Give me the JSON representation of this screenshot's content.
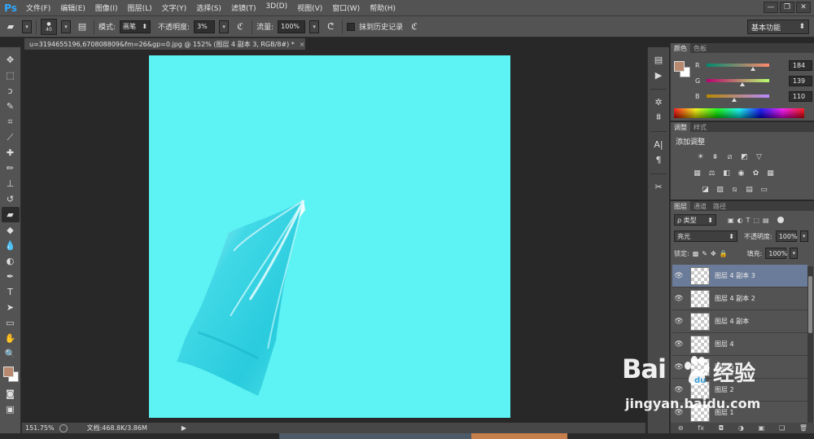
{
  "app": {
    "logo": "Ps"
  },
  "menu": [
    "文件(F)",
    "编辑(E)",
    "图像(I)",
    "图层(L)",
    "文字(Y)",
    "选择(S)",
    "滤镜(T)",
    "3D(D)",
    "视图(V)",
    "窗口(W)",
    "帮助(H)"
  ],
  "window_controls": {
    "minimize": "—",
    "restore": "❐",
    "close": "✕"
  },
  "options": {
    "brush_size": "40",
    "mode_label": "模式:",
    "mode_value": "画笔",
    "opacity_label": "不透明度:",
    "opacity_value": "3%",
    "flow_label": "流量:",
    "flow_value": "100%",
    "history_label": "抹到历史记录",
    "workspace": "基本功能"
  },
  "document": {
    "tab_title": "u=3194655196,670808809&fm=26&gp=0.jpg @ 152% (图层 4 副本 3, RGB/8#) *",
    "tab_close": "×",
    "canvas_color": "#5df2f3"
  },
  "status": {
    "zoom": "151.75%",
    "doc_info": "文档:468.8K/3.86M"
  },
  "tools": [
    "move-tool",
    "marquee-tool",
    "lasso-tool",
    "quick-select-tool",
    "crop-tool",
    "eyedropper-tool",
    "healing-tool",
    "brush-tool",
    "stamp-tool",
    "history-brush-tool",
    "eraser-tool",
    "bucket-tool",
    "blur-tool",
    "dodge-tool",
    "pen-tool",
    "type-tool",
    "path-select-tool",
    "shape-tool",
    "hand-tool",
    "zoom-tool"
  ],
  "tool_glyphs": [
    "✥",
    "⬚",
    "ↄ",
    "✎",
    "⌗",
    "⟋",
    "✚",
    "✏",
    "⊥",
    "↺",
    "▰",
    "◆",
    "💧",
    "◐",
    "✒",
    "T",
    "➤",
    "▭",
    "✋",
    "🔍"
  ],
  "colors": {
    "foreground": "#b8896e",
    "background": "#ffffff"
  },
  "color_panel": {
    "tabs": [
      "颜色",
      "色板"
    ],
    "channels": [
      {
        "label": "R",
        "value": "184",
        "fraction": 0.72,
        "gradient": "linear-gradient(to right,#008a6e,#ff8a6e)"
      },
      {
        "label": "G",
        "value": "139",
        "fraction": 0.55,
        "gradient": "linear-gradient(to right,#b8006e,#b8ff6e)"
      },
      {
        "label": "B",
        "value": "110",
        "fraction": 0.43,
        "gradient": "linear-gradient(to right,#b88900,#b889ff)"
      }
    ]
  },
  "adjust_panel": {
    "tabs": [
      "调整",
      "样式"
    ],
    "title": "添加调整"
  },
  "layers_panel": {
    "tabs": [
      "图层",
      "通道",
      "路径"
    ],
    "filter_type": "ρ 类型",
    "blend_mode": "亮光",
    "opacity_label": "不透明度:",
    "opacity_value": "100%",
    "lock_label": "锁定:",
    "fill_label": "填充:",
    "fill_value": "100%",
    "layers": [
      {
        "name": "图层 4 副本 3",
        "selected": true
      },
      {
        "name": "图层 4 副本 2",
        "selected": false
      },
      {
        "name": "图层 4 副本",
        "selected": false
      },
      {
        "name": "图层 4",
        "selected": false
      },
      {
        "name": "图层 5",
        "selected": false
      },
      {
        "name": "图层 2",
        "selected": false
      },
      {
        "name": "图层 1",
        "selected": false
      }
    ],
    "footer": [
      "⊖",
      "fx",
      "◘",
      "◑",
      "▣",
      "❏",
      "🗑"
    ]
  },
  "watermark": {
    "brand": "Bai",
    "brand_cn": "经验",
    "url": "jingyan.baidu.com"
  }
}
